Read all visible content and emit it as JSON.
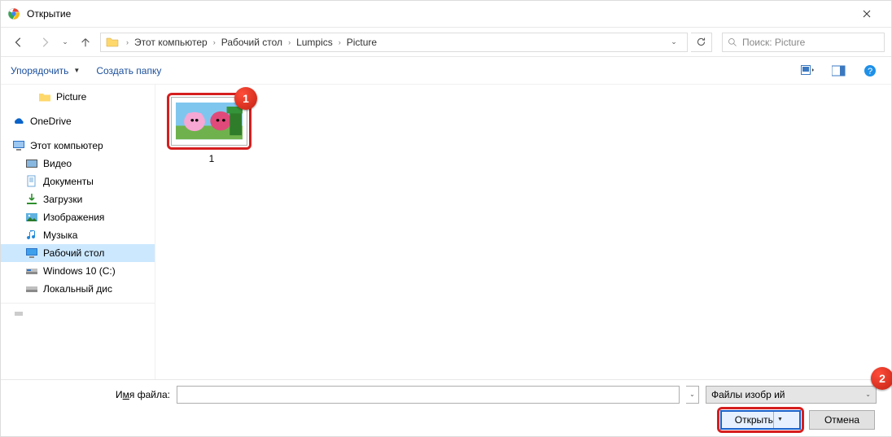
{
  "titlebar": {
    "title": "Открытие"
  },
  "breadcrumbs": {
    "items": [
      "Этот компьютер",
      "Рабочий стол",
      "Lumpics",
      "Picture"
    ]
  },
  "search": {
    "placeholder": "Поиск: Picture"
  },
  "toolbar": {
    "organize": "Упорядочить",
    "new_folder": "Создать папку"
  },
  "sidebar": {
    "picture": "Picture",
    "onedrive": "OneDrive",
    "this_pc": "Этот компьютер",
    "video": "Видео",
    "documents": "Документы",
    "downloads": "Загрузки",
    "images": "Изображения",
    "music": "Музыка",
    "desktop": "Рабочий стол",
    "cdrive": "Windows 10 (C:)",
    "localdisk": "Локальный дис"
  },
  "content": {
    "files": [
      {
        "name": "1"
      }
    ]
  },
  "footer": {
    "filename_label_pre": "И",
    "filename_label_u": "м",
    "filename_label_post": "я файла:",
    "filename_value": "",
    "filetype": "Файлы изобр           ий",
    "open": "Открыть",
    "cancel": "Отмена"
  },
  "badges": {
    "one": "1",
    "two": "2"
  }
}
